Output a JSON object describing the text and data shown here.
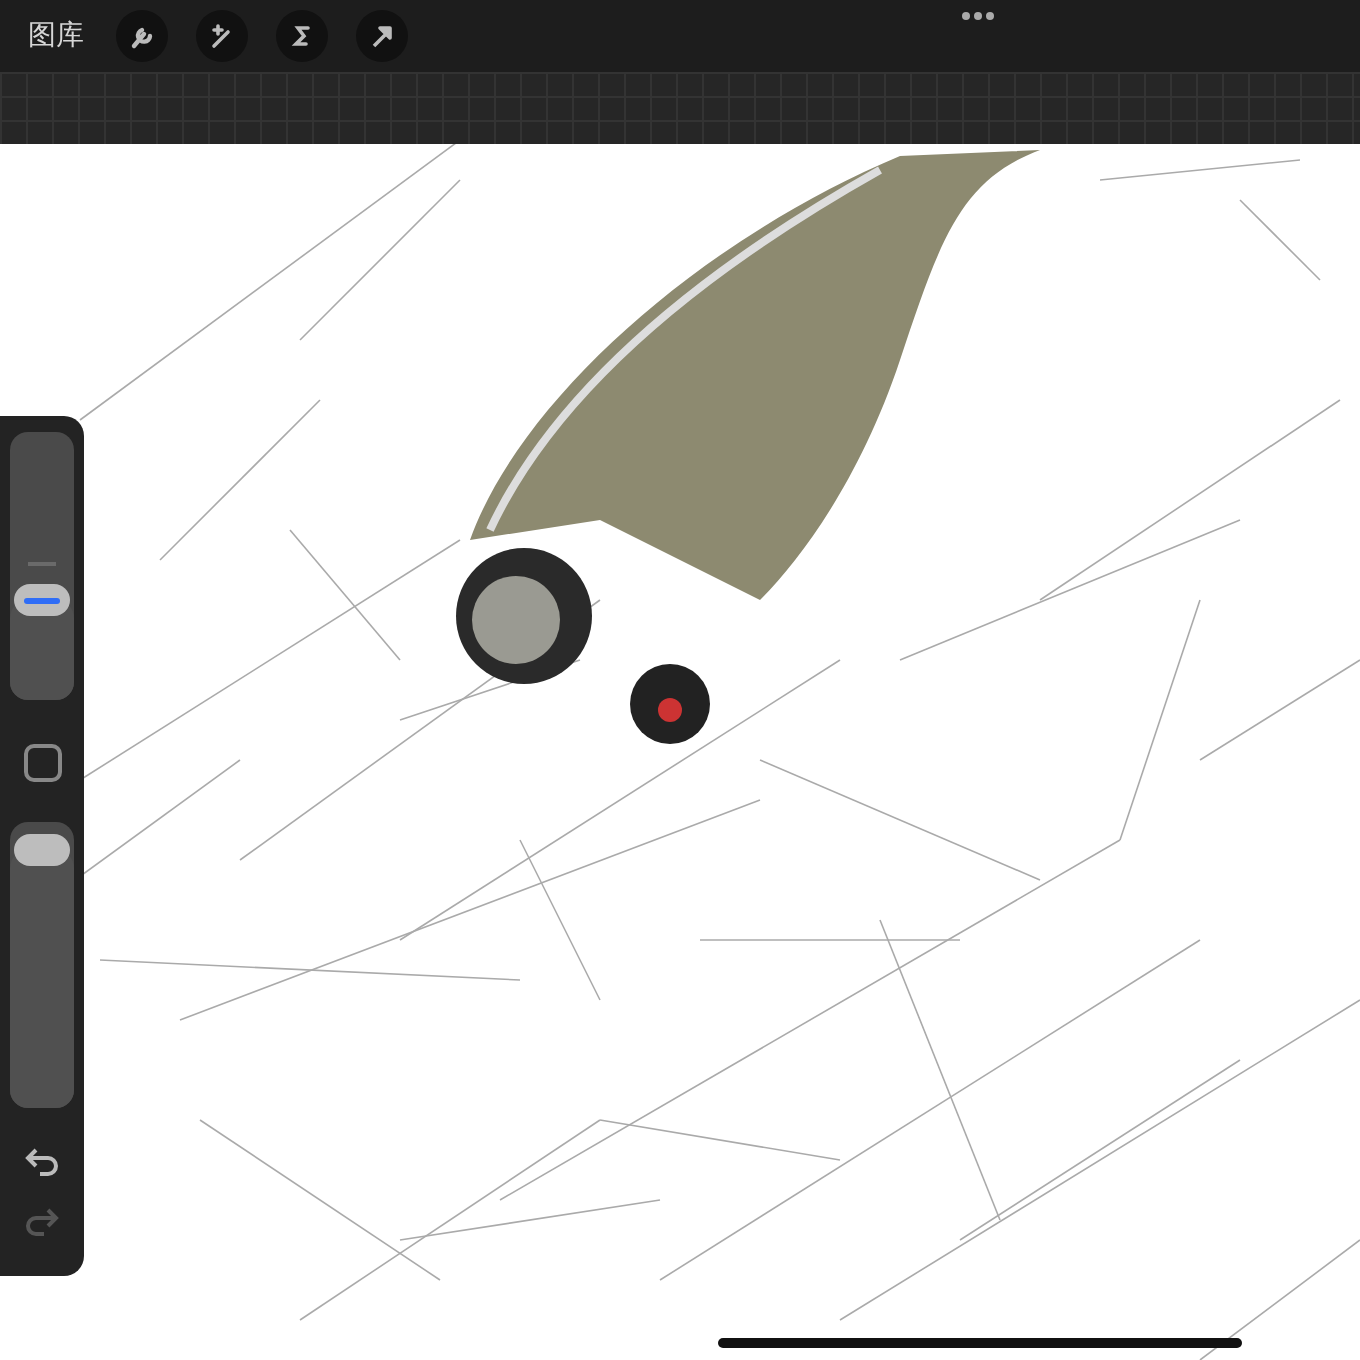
{
  "top_bar": {
    "gallery_label": "图库",
    "tools": [
      {
        "kind": "wrench"
      },
      {
        "kind": "wand"
      },
      {
        "kind": "selection"
      },
      {
        "kind": "arrow"
      }
    ]
  },
  "sidebar": {
    "brush_size": {
      "level": 0.37
    },
    "opacity": {
      "level": 0.9
    },
    "undo": {
      "disabled": false
    },
    "redo": {
      "disabled": true
    }
  }
}
